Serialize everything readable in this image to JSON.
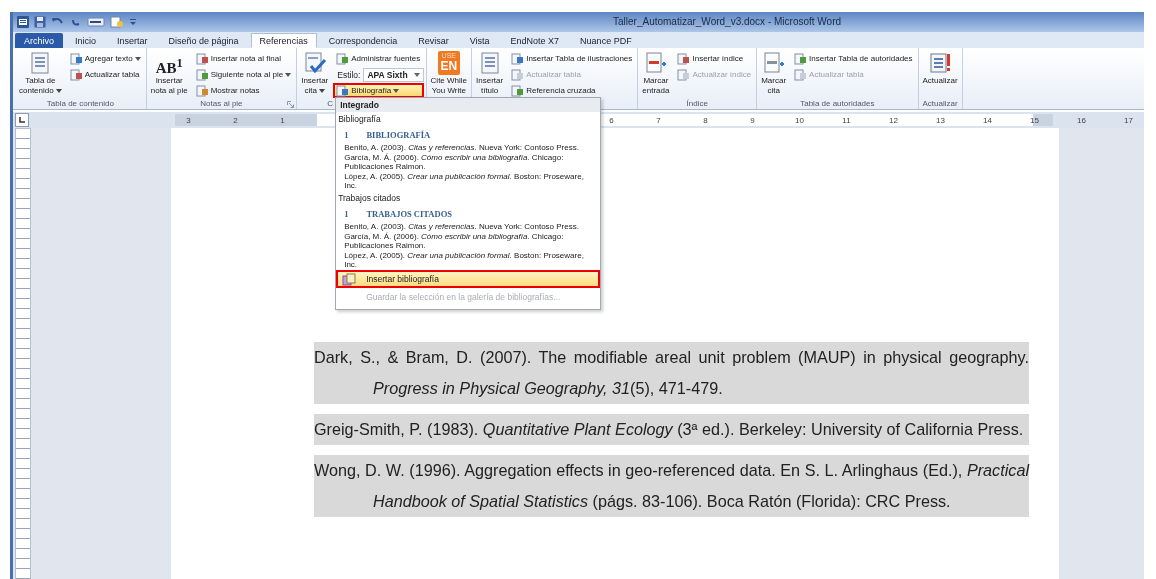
{
  "window": {
    "title": "Taller_Automatizar_Word_v3.docx - Microsoft Word"
  },
  "tabs": [
    {
      "label": "Archivo",
      "kind": "file",
      "selected": false
    },
    {
      "label": "Inicio",
      "kind": "tab",
      "selected": false
    },
    {
      "label": "Insertar",
      "kind": "tab",
      "selected": false
    },
    {
      "label": "Diseño de página",
      "kind": "tab",
      "selected": false
    },
    {
      "label": "Referencias",
      "kind": "tab",
      "selected": true
    },
    {
      "label": "Correspondencia",
      "kind": "tab",
      "selected": false
    },
    {
      "label": "Revisar",
      "kind": "tab",
      "selected": false
    },
    {
      "label": "Vista",
      "kind": "tab",
      "selected": false
    },
    {
      "label": "EndNote X7",
      "kind": "tab",
      "selected": false
    },
    {
      "label": "Nuance PDF",
      "kind": "tab",
      "selected": false
    }
  ],
  "ribbon": {
    "groups": [
      {
        "label": "Tabla de contenido",
        "columns": [
          {
            "kind": "large",
            "label": "Tabla de\ncontenido",
            "dropdown": true
          },
          {
            "kind": "stack",
            "items": [
              {
                "kind": "small",
                "label": "Agregar texto",
                "dropdown": true,
                "disabled": false,
                "selected": false,
                "outlined": false
              },
              {
                "kind": "small",
                "label": "Actualizar tabla",
                "dropdown": false,
                "disabled": false,
                "selected": false,
                "outlined": false
              }
            ]
          }
        ]
      },
      {
        "label": "Notas al pie",
        "launcher": true,
        "columns": [
          {
            "kind": "large",
            "label": "Insertar\nnota al pie",
            "dropdown": false,
            "badge": "AB$^{1}$"
          },
          {
            "kind": "stack",
            "items": [
              {
                "kind": "small",
                "label": "Insertar nota al final",
                "dropdown": false,
                "disabled": false,
                "selected": false,
                "outlined": false
              },
              {
                "kind": "small",
                "label": "Siguiente nota al pie",
                "dropdown": true,
                "disabled": false,
                "selected": false,
                "outlined": false
              },
              {
                "kind": "small",
                "label": "Mostrar notas",
                "dropdown": false,
                "disabled": false,
                "selected": false,
                "outlined": false
              }
            ]
          }
        ]
      },
      {
        "label": "C",
        "columns": [
          {
            "kind": "large",
            "label": "Insertar\ncita",
            "dropdown": true
          },
          {
            "kind": "stack",
            "items": [
              {
                "kind": "small",
                "label": "Administrar fuentes",
                "dropdown": false,
                "disabled": false,
                "selected": false,
                "outlined": false
              },
              {
                "kind": "combo",
                "label": "Estilo:",
                "value": "APA Sixth"
              },
              {
                "kind": "small",
                "label": "Bibliografía",
                "dropdown": true,
                "disabled": false,
                "selected": true,
                "outlined": true
              }
            ]
          }
        ]
      },
      {
        "columns": [
          {
            "kind": "large",
            "label": "Cite While\nYou Write",
            "dropdown": false,
            "badge_lines": [
              "USE",
              "EN"
            ]
          }
        ]
      },
      {
        "columns": [
          {
            "kind": "large",
            "label": "Insertar\ntítulo",
            "dropdown": false
          },
          {
            "kind": "stack",
            "items": [
              {
                "kind": "small",
                "label": "Insertar Tabla de ilustraciones",
                "dropdown": false,
                "disabled": false,
                "selected": false,
                "outlined": false
              },
              {
                "kind": "small",
                "label": "Actualizar tabla",
                "dropdown": false,
                "disabled": true,
                "selected": false,
                "outlined": false
              },
              {
                "kind": "small",
                "label": "Referencia cruzada",
                "dropdown": false,
                "disabled": false,
                "selected": false,
                "outlined": false
              }
            ]
          }
        ]
      },
      {
        "label": "Índice",
        "columns": [
          {
            "kind": "large",
            "label": "Marcar\nentrada",
            "dropdown": false
          },
          {
            "kind": "stack",
            "items": [
              {
                "kind": "small",
                "label": "Insertar índice",
                "dropdown": false,
                "disabled": false,
                "selected": false,
                "outlined": false
              },
              {
                "kind": "small",
                "label": "Actualizar índice",
                "dropdown": false,
                "disabled": true,
                "selected": false,
                "outlined": false
              }
            ]
          }
        ]
      },
      {
        "label": "Tabla de autoridades",
        "columns": [
          {
            "kind": "large",
            "label": "Marcar\ncita",
            "dropdown": false
          },
          {
            "kind": "stack",
            "items": [
              {
                "kind": "small",
                "label": "Insertar Tabla de autoridades",
                "dropdown": false,
                "disabled": false,
                "selected": false,
                "outlined": false
              },
              {
                "kind": "small",
                "label": "Actualizar tabla",
                "dropdown": false,
                "disabled": true,
                "selected": false,
                "outlined": false
              }
            ]
          }
        ]
      },
      {
        "label": "Actualizar",
        "columns": [
          {
            "kind": "large",
            "label": "Actualizar",
            "dropdown": false
          }
        ]
      }
    ]
  },
  "ruler": {
    "left_labels": [
      "3",
      "2",
      "1"
    ],
    "right_labels": [
      "6",
      "7",
      "8",
      "9",
      "10",
      "11",
      "12",
      "13",
      "14",
      "15",
      "16",
      "17"
    ]
  },
  "bibliography_menu": {
    "section": "Integrado",
    "entries": [
      {
        "title": "Bibliografía",
        "heading_number": "1",
        "heading": "BIBLIOGRAFÍA",
        "lines": [
          "Benito, A. (2003). *Citas y referencias*. Nueva York: Contoso Press.",
          "García, M. Á. (2006). *Cómo escribir una bibliografía*. Chicago: Publicaciones Raimon.",
          "López, A. (2005). *Crear una publicación formal*. Boston: Proseware, Inc."
        ]
      },
      {
        "title": "Trabajos citados",
        "heading_number": "1",
        "heading": "TRABAJOS CITADOS",
        "lines": [
          "Benito, A. (2003). *Citas y referencias*. Nueva York: Contoso Press.",
          "García, M. Á. (2006). *Cómo escribir una bibliografía*. Chicago: Publicaciones Raimon.",
          "López, A. (2005). *Crear una publicación formal*. Boston: Proseware, Inc."
        ]
      }
    ],
    "actions": [
      {
        "label": "Insertar bibliografía",
        "selected": true,
        "disabled": false,
        "outlined": true
      },
      {
        "label": "Guardar la selección en la galería de bibliografías...",
        "selected": false,
        "disabled": true,
        "outlined": false
      }
    ]
  },
  "references": [
    "Dark, S., & Bram, D. (2007). The modifiable areal unit problem (MAUP) in physical geography. *Progress in Physical Geography, 31*(5), 471-479.",
    "Greig-Smith, P. (1983). *Quantitative Plant Ecology* (3ª ed.). Berkeley: University of California Press.",
    "Wong, D. W. (1996). Aggregation effects in geo-referenced data. En S. L. Arlinghaus (Ed.), *Practical Handbook of Spatial Statistics* (págs. 83-106). Boca Ratón (Florida): CRC Press."
  ]
}
